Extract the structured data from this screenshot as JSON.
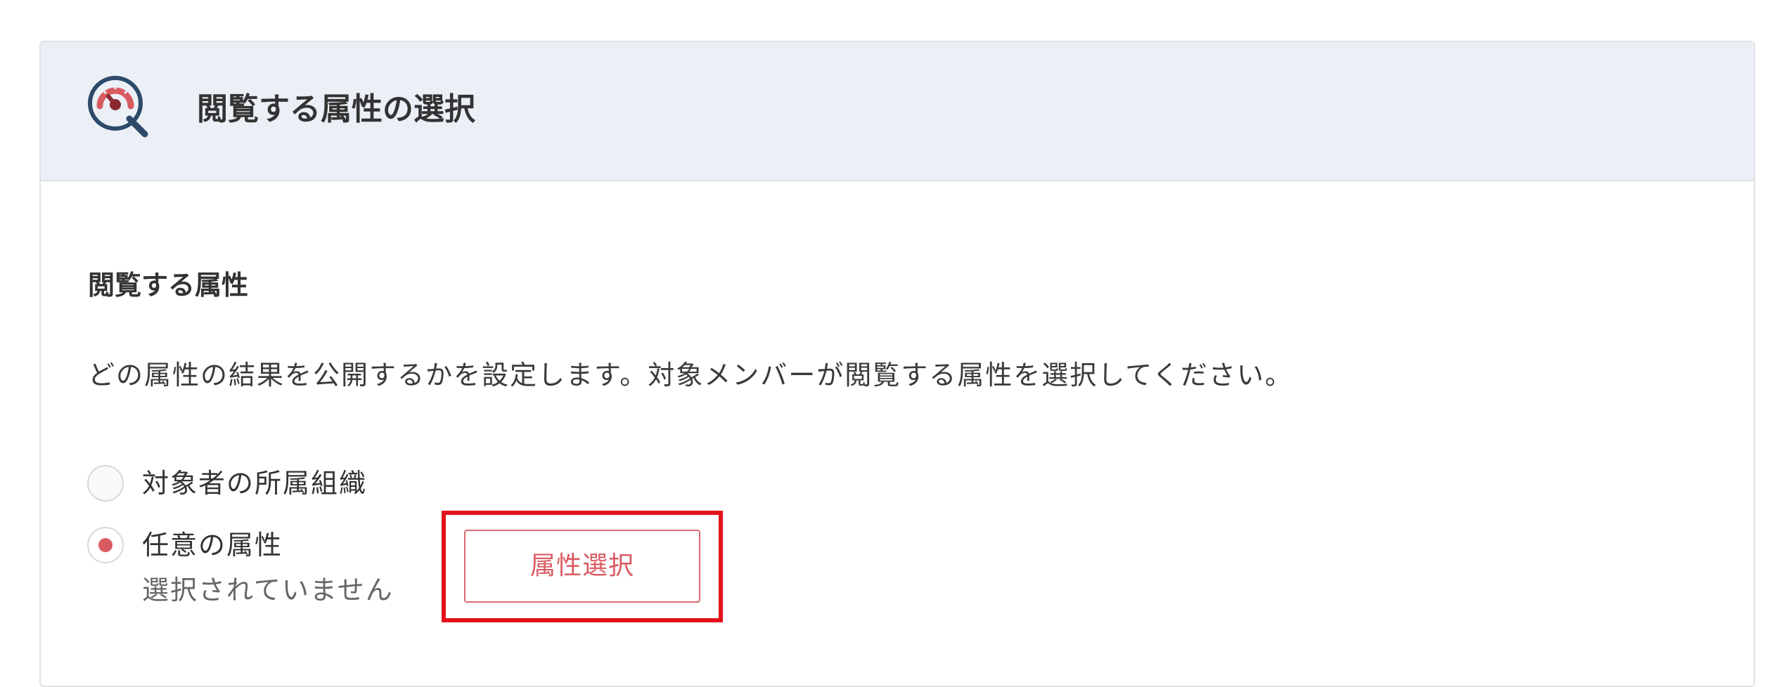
{
  "panel": {
    "title": "閲覧する属性の選択",
    "icon": "gauge-search-icon"
  },
  "section": {
    "title": "閲覧する属性",
    "description": "どの属性の結果を公開するかを設定します。対象メンバーが閲覧する属性を選択してください。"
  },
  "options": [
    {
      "label": "対象者の所属組織",
      "selected": false
    },
    {
      "label": "任意の属性",
      "selected": true
    }
  ],
  "selection_status": "選択されていません",
  "attr_button_label": "属性選択",
  "colors": {
    "accent": "#d95b62",
    "header_bg": "#ebf0f7",
    "highlight": "#e3121c",
    "icon_navy": "#2d4a6a"
  }
}
